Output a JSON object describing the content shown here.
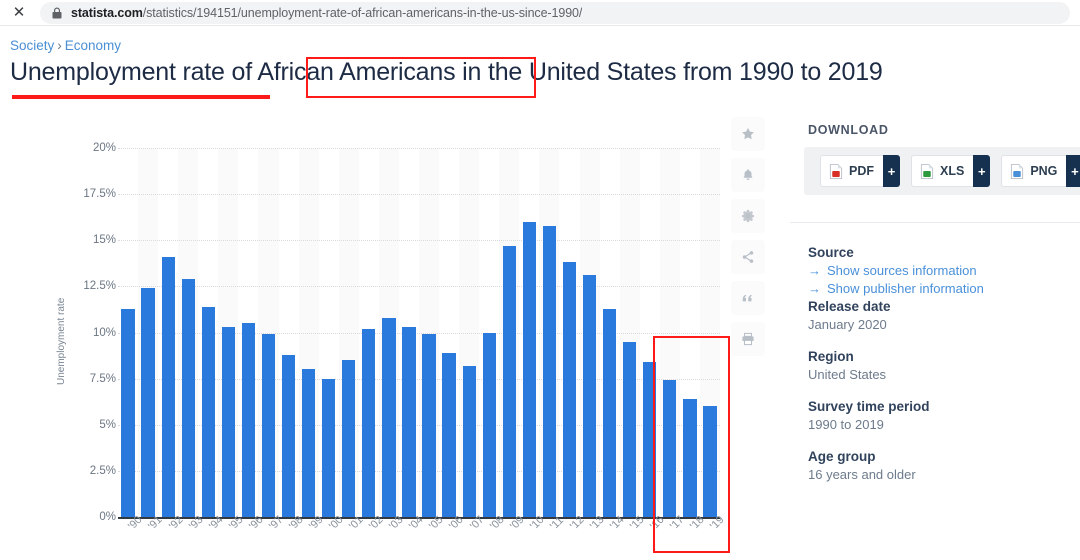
{
  "browser": {
    "close_label": "✕",
    "lock_icon": "lock-icon",
    "url_host": "statista.com",
    "url_path": "/statistics/194151/unemployment-rate-of-african-americans-in-the-us-since-1990/"
  },
  "breadcrumb": {
    "item1": "Society",
    "separator": "›",
    "item2": "Economy"
  },
  "page": {
    "title": "Unemployment rate of African Americans in the United States from 1990 to 2019",
    "title_part1": "Unemployment rate of ",
    "title_part2": "African Americans",
    "title_part3": " in the United States from 1990 to 2019"
  },
  "annotations": {
    "color": "#ff1a1a",
    "underline_target": "Unemployment rate",
    "box_title_target": "African Americans",
    "box_bars_target": "'17 '18 '19"
  },
  "chart_tools": [
    {
      "name": "favorite-star-icon",
      "glyph": "★"
    },
    {
      "name": "alert-bell-icon",
      "glyph": "🔔"
    },
    {
      "name": "settings-gear-icon",
      "glyph": "⚙"
    },
    {
      "name": "share-icon",
      "glyph": "share"
    },
    {
      "name": "citation-quote-icon",
      "glyph": "”"
    },
    {
      "name": "print-icon",
      "glyph": "print"
    }
  ],
  "sidebar": {
    "download_title": "DOWNLOAD",
    "download_buttons": [
      {
        "label": "PDF",
        "icon": "pdf-file-icon",
        "color": "#d93025",
        "plus": "+"
      },
      {
        "label": "XLS",
        "icon": "xls-file-icon",
        "color": "#2e9a3e",
        "plus": "+"
      },
      {
        "label": "PNG",
        "icon": "png-image-icon",
        "color": "#4a90d9",
        "plus": "+"
      },
      {
        "label": "",
        "icon": "ppt-file-icon",
        "color": "#e8821e",
        "plus": "+"
      }
    ],
    "source_heading": "Source",
    "source_links": [
      {
        "arrow": "→",
        "label": "Show sources information"
      },
      {
        "arrow": "→",
        "label": "Show publisher information"
      }
    ],
    "meta": [
      {
        "heading": "Release date",
        "value": "January 2020"
      },
      {
        "heading": "Region",
        "value": "United States"
      },
      {
        "heading": "Survey time period",
        "value": "1990 to 2019"
      },
      {
        "heading": "Age group",
        "value": "16 years and older"
      }
    ]
  },
  "chart_data": {
    "type": "bar",
    "title": "Unemployment rate of African Americans in the United States from 1990 to 2019",
    "xlabel": "",
    "ylabel": "Unemployment rate",
    "ylim": [
      0,
      20
    ],
    "ytick_labels": [
      "20%",
      "17.5%",
      "15%",
      "12.5%",
      "10%",
      "7.5%",
      "5%",
      "2.5%",
      "0%"
    ],
    "ytick_values": [
      20,
      17.5,
      15,
      12.5,
      10,
      7.5,
      5,
      2.5,
      0
    ],
    "grid": true,
    "legend": "none",
    "bar_color": "#2a7ade",
    "categories": [
      "'90",
      "'91",
      "'92",
      "'93",
      "'94",
      "'95",
      "'96",
      "'97",
      "'98",
      "'99",
      "'00",
      "'01",
      "'02",
      "'03",
      "'04",
      "'05",
      "'06",
      "'07",
      "'08",
      "'09",
      "'10",
      "'11",
      "'12",
      "'13",
      "'14",
      "'15",
      "'16",
      "'17",
      "'18",
      "'19"
    ],
    "values": [
      11.3,
      12.4,
      14.1,
      12.9,
      11.4,
      10.3,
      10.5,
      9.9,
      8.8,
      8.0,
      7.5,
      8.5,
      10.2,
      10.8,
      10.3,
      9.9,
      8.9,
      8.2,
      10.0,
      14.7,
      16.0,
      15.8,
      13.8,
      13.1,
      11.3,
      9.5,
      8.4,
      7.4,
      6.4,
      6.0
    ],
    "highlighted_range": [
      "'17",
      "'18",
      "'19"
    ]
  }
}
